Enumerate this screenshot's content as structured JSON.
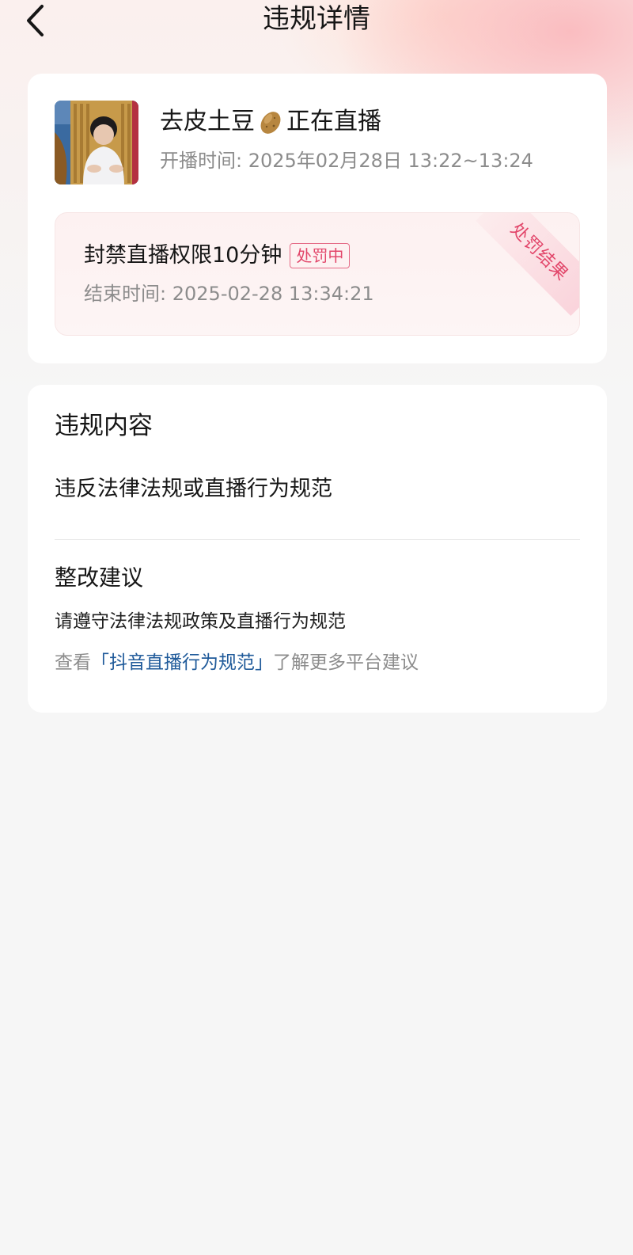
{
  "nav": {
    "title": "违规详情"
  },
  "live": {
    "title_prefix": "去皮土豆",
    "title_emoji": "potato-emoji",
    "title_suffix": "正在直播",
    "time_label": "开播时间:",
    "time_value": "2025年02月28日 13:22~13:24"
  },
  "penalty": {
    "title": "封禁直播权限10分钟",
    "badge": "处罚中",
    "end_label": "结束时间:",
    "end_value": "2025-02-28 13:34:21",
    "ribbon": "处罚结果"
  },
  "violation": {
    "heading": "违规内容",
    "content": "违反法律法规或直播行为规范"
  },
  "advice": {
    "heading": "整改建议",
    "content": "请遵守法律法规政策及直播行为规范",
    "more_prefix": "查看",
    "more_link": "「抖音直播行为规范」",
    "more_suffix": "了解更多平台建议"
  },
  "colors": {
    "accent_red": "#e2466a",
    "link_blue": "#1f5a9a",
    "muted_gray": "#8c8c8c"
  }
}
